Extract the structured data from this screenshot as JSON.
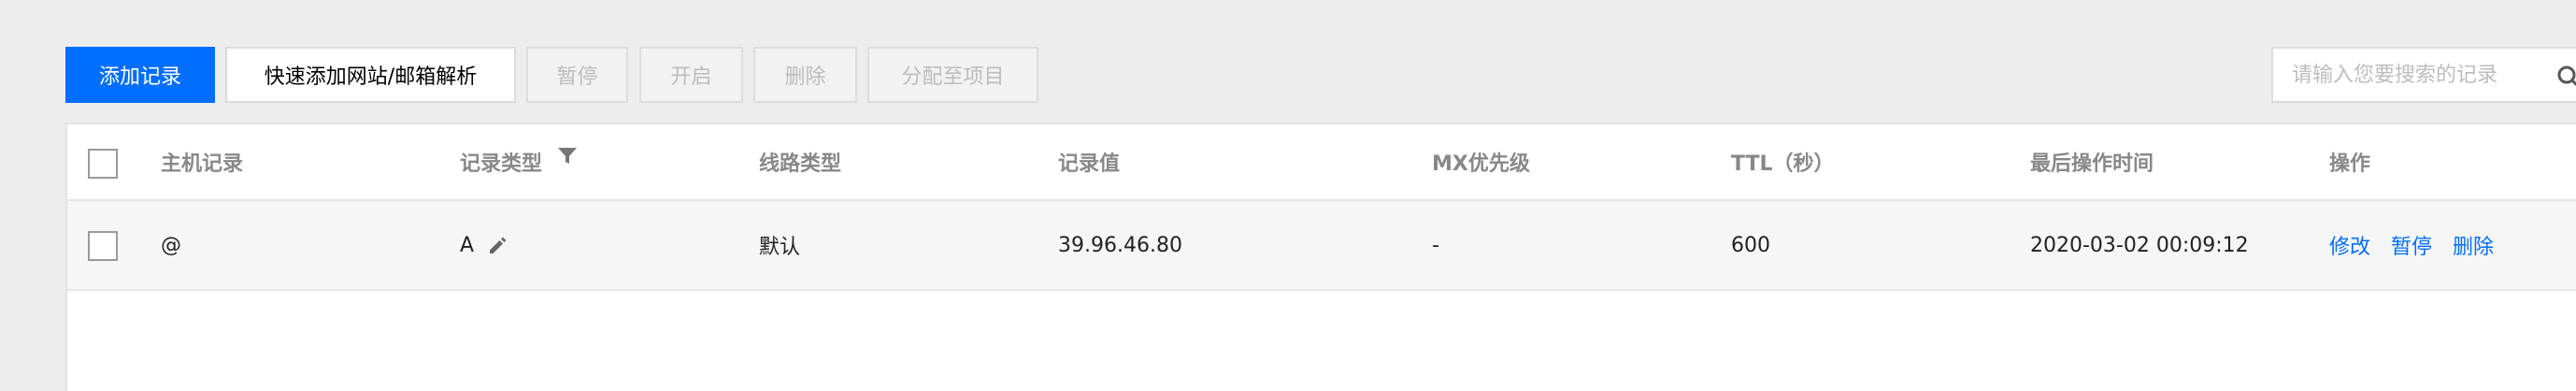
{
  "toolbar": {
    "add_record_label": "添加记录",
    "quick_add_label": "快速添加网站/邮箱解析",
    "pause_label": "暂停",
    "start_label": "开启",
    "delete_label": "删除",
    "assign_label": "分配至项目"
  },
  "search": {
    "placeholder": "请输入您要搜索的记录",
    "value": ""
  },
  "table": {
    "headers": [
      "主机记录",
      "记录类型",
      "线路类型",
      "记录值",
      "MX优先级",
      "TTL（秒）",
      "最后操作时间",
      "操作"
    ],
    "rows": [
      {
        "host": "@",
        "type": "A",
        "line": "默认",
        "value": "39.96.46.80",
        "mx": "-",
        "ttl": "600",
        "updated": "2020-03-02 00:09:12",
        "actions": [
          "修改",
          "暂停",
          "删除"
        ]
      }
    ]
  },
  "colors": {
    "primary": "#006eff",
    "page_background": "#ededed",
    "disabled_text": "#bcbcbc"
  },
  "icons": [
    "filter-icon",
    "edit-icon",
    "search-icon",
    "checkbox"
  ]
}
